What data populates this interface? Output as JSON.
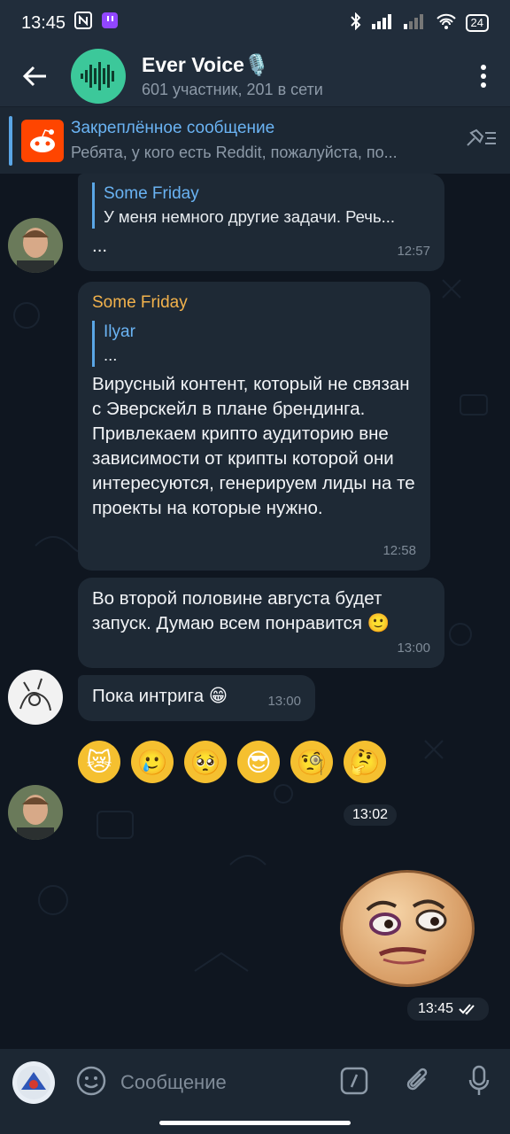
{
  "status": {
    "time": "13:45",
    "battery": "24"
  },
  "header": {
    "title": "Ever Voice🎙️",
    "subtitle": "601 участник, 201 в сети"
  },
  "pinned": {
    "title": "Закреплённое сообщение",
    "body": "Ребята, у кого есть Reddit, пожалуйста, по..."
  },
  "messages": {
    "m1": {
      "quote_name": "Some Friday",
      "quote_text": "У меня немного другие задачи. Речь...",
      "text": "...",
      "time": "12:57"
    },
    "m2": {
      "author": "Some Friday",
      "quote_name": "Ilyar",
      "quote_text": "...",
      "text": "Вирусный контент, который не связан с Эверскейл в плане брендинга. Привлекаем крипто аудиторию вне зависимости от крипты которой они интересуются, генерируем лиды на те проекты на которые нужно.",
      "time": "12:58"
    },
    "m3": {
      "text": "Во второй половине августа будет запуск. Думаю всем понравится 🙂",
      "time": "13:00"
    },
    "m4": {
      "text": "Пока интрига 😁",
      "time": "13:00"
    },
    "m5": {
      "emojis": [
        "😿",
        "🥲",
        "🥺",
        "😎",
        "🧐",
        "🤔"
      ],
      "time": "13:02"
    },
    "m6": {
      "time": "13:45"
    }
  },
  "composer": {
    "placeholder": "Сообщение"
  }
}
